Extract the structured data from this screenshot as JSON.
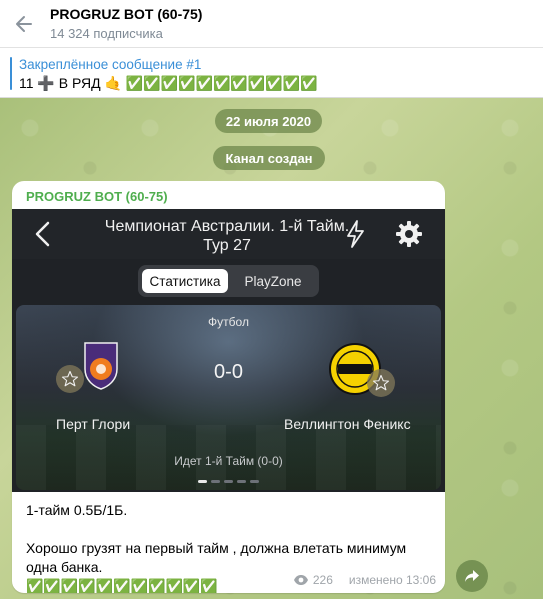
{
  "header": {
    "title": "PROGRUZ BOT (60-75)",
    "subtitle": "14 324 подписчика"
  },
  "pinned": {
    "title": "Закреплённое сообщение #1",
    "text": "11 ➕ В РЯД 🤙 ✅✅✅✅✅✅✅✅✅✅✅"
  },
  "service": {
    "date": "22 июля 2020",
    "created": "Канал создан"
  },
  "message": {
    "author": "PROGRUZ BOT (60-75)",
    "screenshot": {
      "title_line1": "Чемпионат Австралии. 1-й Тайм.",
      "title_line2": "Тур 27",
      "tab_active": "Статистика",
      "tab_other": "PlayZone",
      "sport": "Футбол",
      "score": "0-0",
      "team_left": "Перт Глори",
      "team_right": "Веллингтон Феникс",
      "period": "Идет 1-й Тайм (0-0)",
      "pager_pages": 5,
      "pager_active": 0
    },
    "line1": "1-тайм 0.5Б/1Б.",
    "line2": "Хорошо грузят на первый тайм , должна влетать минимум одна банка.",
    "line3": "✅✅✅✅✅✅✅✅✅✅✅",
    "views": "226",
    "edited": "изменено 13:06"
  },
  "colors": {
    "author": "#4fae4e",
    "pinned_title": "#3a8fd7",
    "accent": "#3a8fd7"
  }
}
